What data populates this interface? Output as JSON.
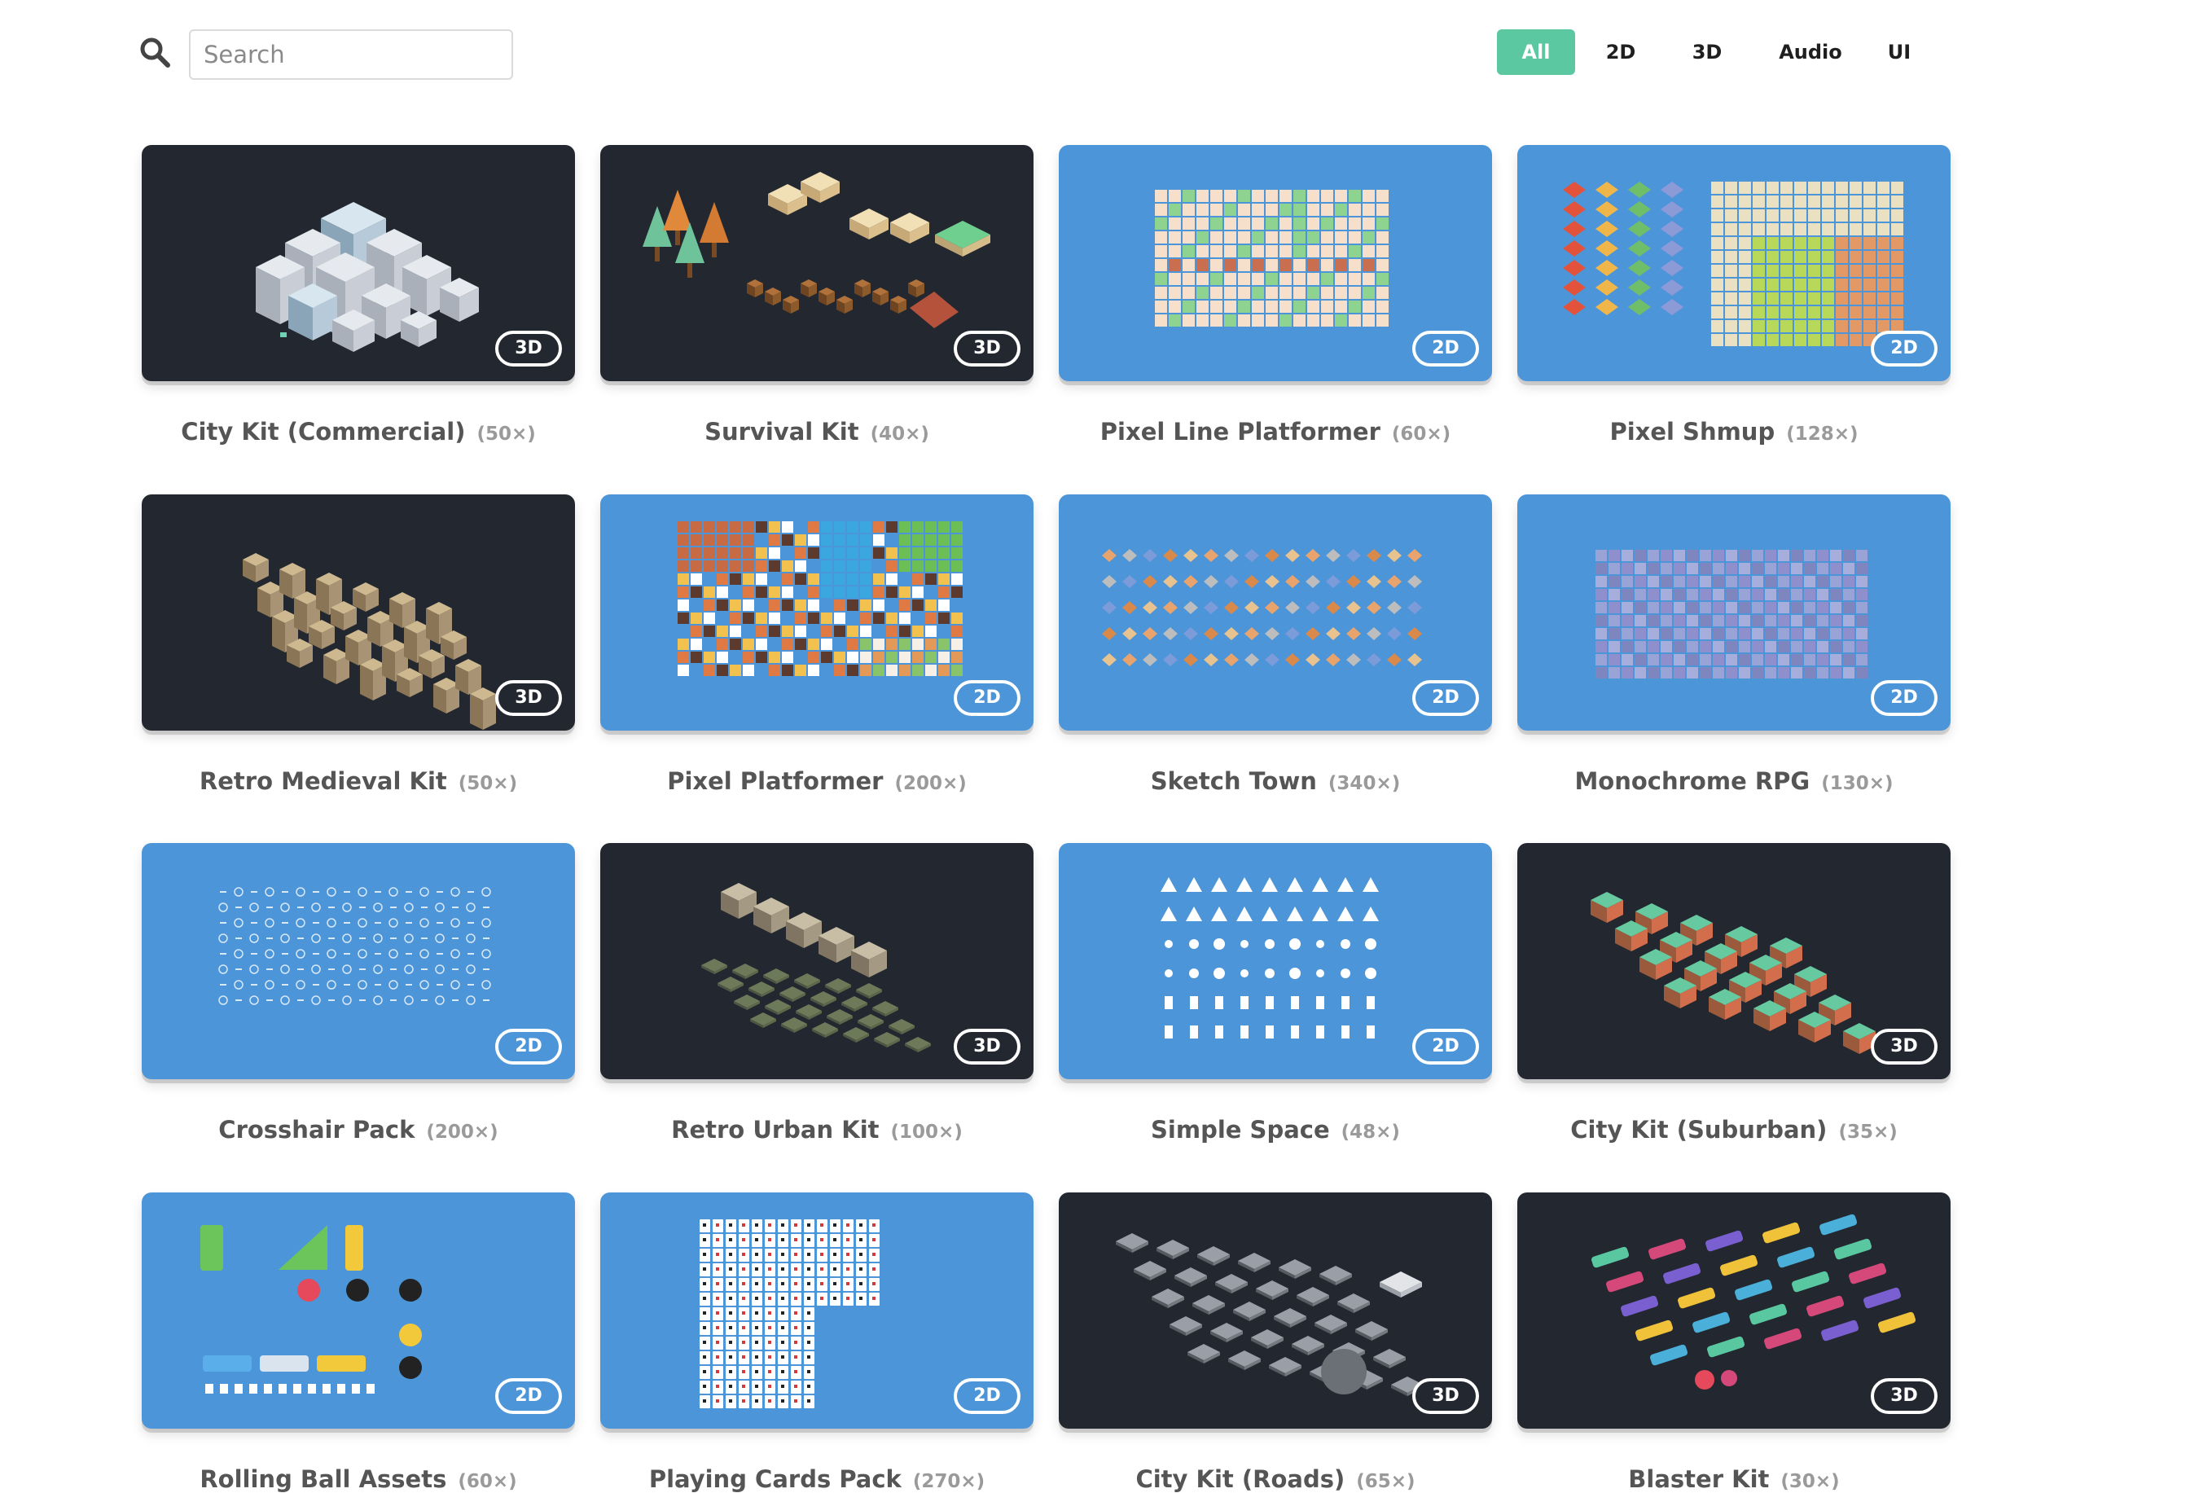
{
  "search": {
    "placeholder": "Search",
    "value": ""
  },
  "filters": [
    {
      "label": "All",
      "active": true
    },
    {
      "label": "2D",
      "active": false
    },
    {
      "label": "3D",
      "active": false
    },
    {
      "label": "Audio",
      "active": false
    },
    {
      "label": "UI",
      "active": false
    }
  ],
  "colors": {
    "accent": "#5cc8a2",
    "dark_thumb": "#232730",
    "blue_thumb": "#4c95d9"
  },
  "cards": [
    {
      "name": "City Kit (Commercial)",
      "count": "(50×)",
      "type": "3D",
      "theme": "dark",
      "art": "city"
    },
    {
      "name": "Survival Kit",
      "count": "(40×)",
      "type": "3D",
      "theme": "dark",
      "art": "survival"
    },
    {
      "name": "Pixel Line Platformer",
      "count": "(60×)",
      "type": "2D",
      "theme": "blue",
      "art": "tiles-light"
    },
    {
      "name": "Pixel Shmup",
      "count": "(128×)",
      "type": "2D",
      "theme": "blue",
      "art": "shmup"
    },
    {
      "name": "Retro Medieval Kit",
      "count": "(50×)",
      "type": "3D",
      "theme": "dark",
      "art": "medieval"
    },
    {
      "name": "Pixel Platformer",
      "count": "(200×)",
      "type": "2D",
      "theme": "blue",
      "art": "platformer"
    },
    {
      "name": "Sketch Town",
      "count": "(340×)",
      "type": "2D",
      "theme": "blue",
      "art": "sketch"
    },
    {
      "name": "Monochrome RPG",
      "count": "(130×)",
      "type": "2D",
      "theme": "blue",
      "art": "mono"
    },
    {
      "name": "Crosshair Pack",
      "count": "(200×)",
      "type": "2D",
      "theme": "blue",
      "art": "crosshair"
    },
    {
      "name": "Retro Urban Kit",
      "count": "(100×)",
      "type": "3D",
      "theme": "dark",
      "art": "urban"
    },
    {
      "name": "Simple Space",
      "count": "(48×)",
      "type": "2D",
      "theme": "blue",
      "art": "space"
    },
    {
      "name": "City Kit (Suburban)",
      "count": "(35×)",
      "type": "3D",
      "theme": "dark",
      "art": "suburban"
    },
    {
      "name": "Rolling Ball Assets",
      "count": "(60×)",
      "type": "2D",
      "theme": "blue",
      "art": "rolling"
    },
    {
      "name": "Playing Cards Pack",
      "count": "(270×)",
      "type": "2D",
      "theme": "blue",
      "art": "cards"
    },
    {
      "name": "City Kit (Roads)",
      "count": "(65×)",
      "type": "3D",
      "theme": "dark",
      "art": "roads"
    },
    {
      "name": "Blaster Kit",
      "count": "(30×)",
      "type": "3D",
      "theme": "dark",
      "art": "blaster"
    }
  ]
}
